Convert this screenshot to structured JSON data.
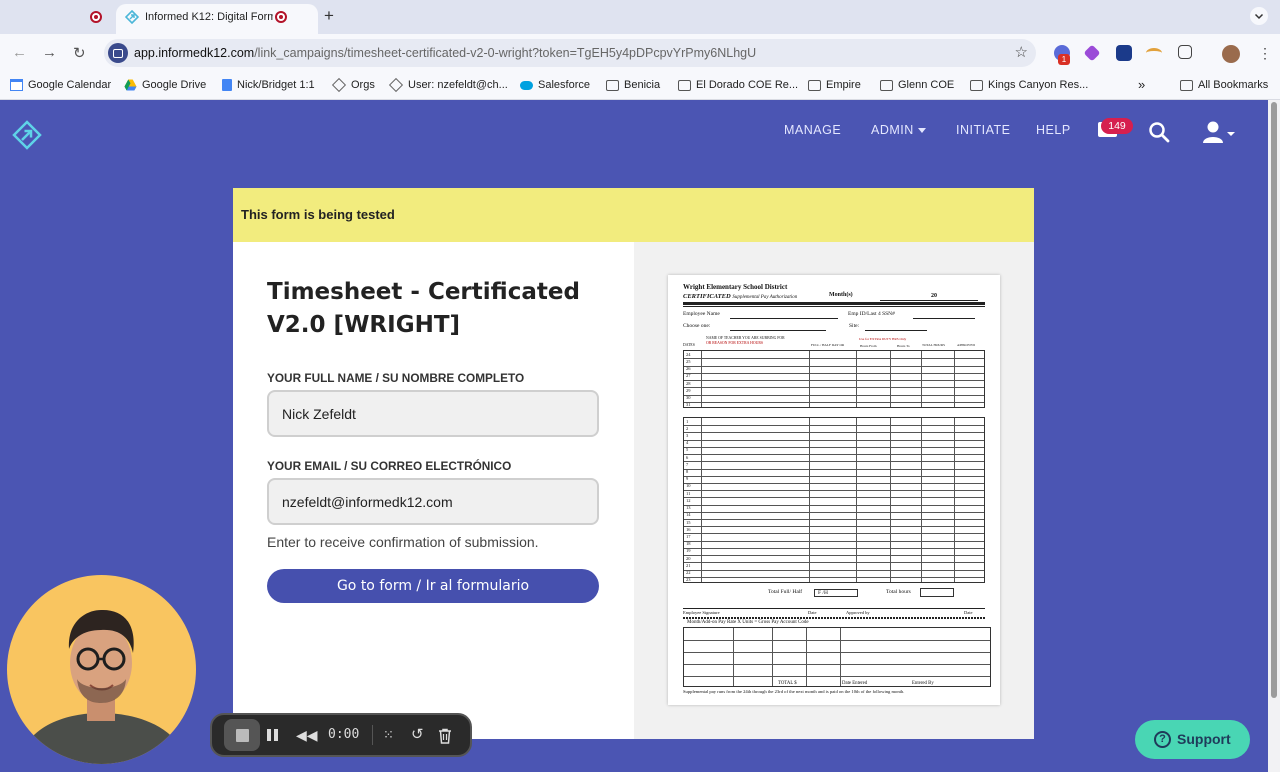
{
  "browser": {
    "tab_title": "Informed K12: Digital Form",
    "url_host": "app.informedk12.com",
    "url_path": "/link_campaigns/timesheet-certificated-v2-0-wright?token=TgEH5y4pDPcpvYrPmy6NLhgU",
    "extension_badge": "1",
    "bookmarks": [
      {
        "label": "Google Calendar",
        "icon": "calendar-icon"
      },
      {
        "label": "Google Drive",
        "icon": "drive-icon"
      },
      {
        "label": "Nick/Bridget 1:1",
        "icon": "doc-icon"
      },
      {
        "label": "Orgs",
        "icon": "informed-icon"
      },
      {
        "label": "User: nzefeldt@ch...",
        "icon": "informed-icon"
      },
      {
        "label": "Salesforce",
        "icon": "salesforce-icon"
      },
      {
        "label": "Benicia",
        "icon": "folder-icon"
      },
      {
        "label": "El Dorado COE Re...",
        "icon": "folder-icon"
      },
      {
        "label": "Empire",
        "icon": "folder-icon"
      },
      {
        "label": "Glenn COE",
        "icon": "folder-icon"
      },
      {
        "label": "Kings Canyon Res...",
        "icon": "folder-icon"
      }
    ],
    "more_bookmarks": "»",
    "all_bookmarks": "All Bookmarks"
  },
  "app": {
    "nav": {
      "manage": "MANAGE",
      "admin": "ADMIN",
      "initiate": "INITIATE",
      "help": "HELP"
    },
    "inbox_count": "149",
    "accent": "#4b55b3"
  },
  "banner": {
    "text": "This form is being tested",
    "color": "#f2ec7e"
  },
  "form": {
    "title": "Timesheet - Certificated V2.0 [WRIGHT]",
    "name_label": "YOUR FULL NAME / SU NOMBRE COMPLETO",
    "name_value": "Nick Zefeldt",
    "email_label": "YOUR EMAIL / SU CORREO ELECTRÓNICO",
    "email_value": "nzefeldt@informedk12.com",
    "email_help": "Enter to receive confirmation of submission.",
    "submit_label": "Go to form / Ir al formulario",
    "button_color": "#4650ae"
  },
  "preview": {
    "district": "Wright Elementary School District",
    "subtitle_bold": "CERTIFICATED",
    "subtitle_rest": "Supplemental Pay Authorization",
    "month_label": "Month(s)",
    "year": "20",
    "employee_name": "Employee Name",
    "emp_id": "Emp ID/Last 4 SSN#",
    "choose_one": "Choose one:",
    "site": "Site:",
    "teacher_note": "NAME OF TEACHER YOU ARE SUBBING FOR",
    "or_note": "OR REASON FOR EXTRA HOURS",
    "col_dates": "DATES",
    "col_full_half": "FULL / HALF DAY OR",
    "col_extra": "Use for EXTRA DUTY HRS Only",
    "col_hours_from": "Hours From",
    "col_hours_to": "Hours To",
    "col_total": "TOTAL HOURS",
    "col_approved": "APPROVED",
    "days_top": [
      "24",
      "25",
      "26",
      "27",
      "28",
      "29",
      "30",
      "31"
    ],
    "days_bottom": [
      "1",
      "2",
      "3",
      "4",
      "5",
      "6",
      "7",
      "8",
      "9",
      "10",
      "11",
      "12",
      "13",
      "14",
      "15",
      "16",
      "17",
      "18",
      "19",
      "20",
      "21",
      "22",
      "23"
    ],
    "total_full_half": "Total Full/ Half",
    "f_h": "F  /H",
    "total_hours": "Total  hours",
    "employee_signature": "Employee Signature",
    "date": "Date",
    "approved_by": "Approved by",
    "pay_header": "Month/Add-on   Pay Rate  X   Units    =   Gross Pay    Account Code",
    "total_dollar": "TOTAL $",
    "date_entered": "Date Entered",
    "entered_by": "Entered By",
    "footer": "Supplemental pay runs from the 24th through the 23rd of the next month and is paid on the 10th of the following month."
  },
  "recorder": {
    "time": "0:00"
  },
  "support": {
    "label": "Support"
  }
}
